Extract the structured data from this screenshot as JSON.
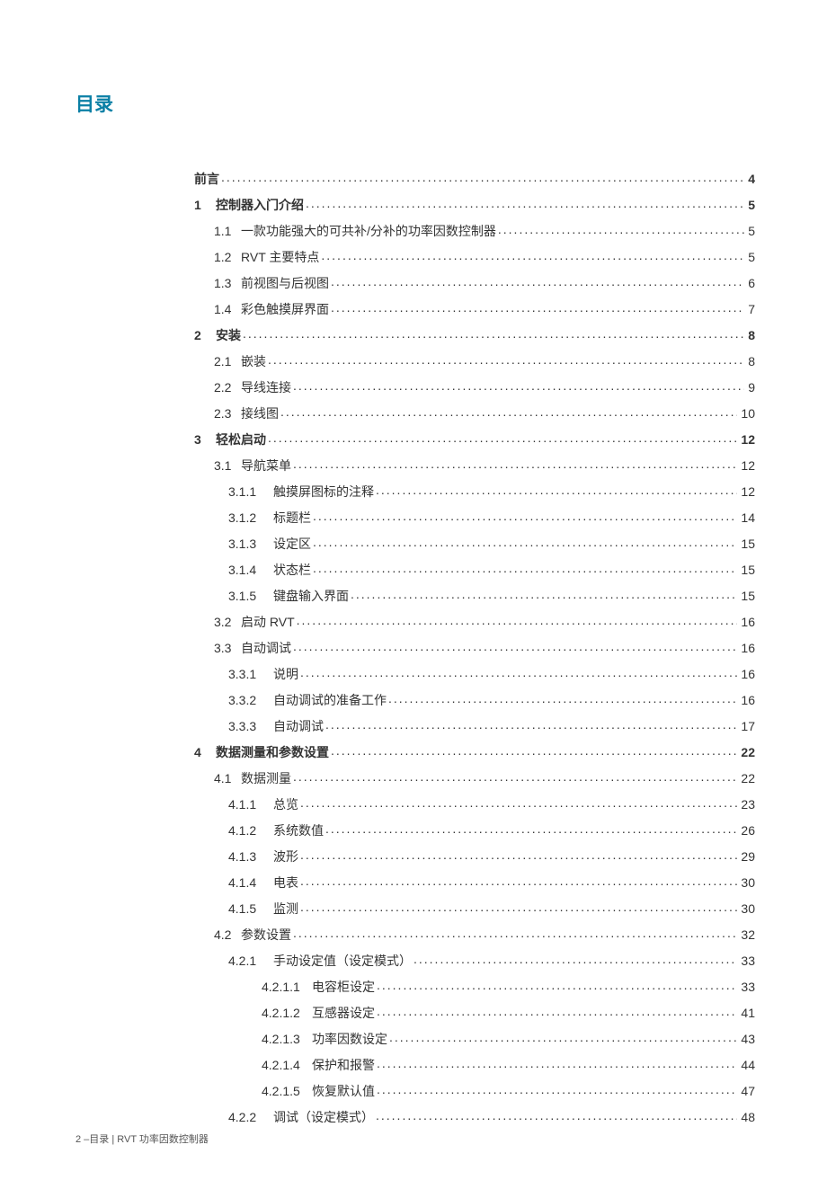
{
  "title": "目录",
  "footer": "2 –目录 | RVT 功率因数控制器",
  "toc": [
    {
      "level": 0,
      "bold": true,
      "num": "",
      "text": "前言",
      "page": "4"
    },
    {
      "level": 1,
      "bold": true,
      "num": "1",
      "text": "控制器入门介绍",
      "page": "5"
    },
    {
      "level": 2,
      "bold": false,
      "num": "1.1",
      "text": "一款功能强大的可共补/分补的功率因数控制器",
      "page": "5"
    },
    {
      "level": 2,
      "bold": false,
      "num": "1.2",
      "text": "RVT 主要特点",
      "page": "5"
    },
    {
      "level": 2,
      "bold": false,
      "num": "1.3",
      "text": "前视图与后视图",
      "page": "6"
    },
    {
      "level": 2,
      "bold": false,
      "num": "1.4",
      "text": "彩色触摸屏界面",
      "page": "7"
    },
    {
      "level": 1,
      "bold": true,
      "num": "2",
      "text": "安装",
      "page": "8"
    },
    {
      "level": 2,
      "bold": false,
      "num": "2.1",
      "text": "嵌装",
      "page": "8"
    },
    {
      "level": 2,
      "bold": false,
      "num": "2.2",
      "text": "导线连接",
      "page": "9"
    },
    {
      "level": 2,
      "bold": false,
      "num": "2.3",
      "text": "接线图",
      "page": "10"
    },
    {
      "level": 1,
      "bold": true,
      "num": "3",
      "text": "轻松启动",
      "page": "12"
    },
    {
      "level": 2,
      "bold": false,
      "num": "3.1",
      "text": "导航菜单",
      "page": "12"
    },
    {
      "level": 3,
      "bold": false,
      "num": "3.1.1",
      "text": "触摸屏图标的注释",
      "page": "12"
    },
    {
      "level": 3,
      "bold": false,
      "num": "3.1.2",
      "text": "标题栏",
      "page": "14"
    },
    {
      "level": 3,
      "bold": false,
      "num": "3.1.3",
      "text": "设定区",
      "page": "15"
    },
    {
      "level": 3,
      "bold": false,
      "num": "3.1.4",
      "text": "状态栏",
      "page": "15"
    },
    {
      "level": 3,
      "bold": false,
      "num": "3.1.5",
      "text": "键盘输入界面",
      "page": "15"
    },
    {
      "level": 2,
      "bold": false,
      "num": "3.2",
      "text": "启动 RVT",
      "page": "16"
    },
    {
      "level": 2,
      "bold": false,
      "num": "3.3",
      "text": "自动调试",
      "page": "16"
    },
    {
      "level": 3,
      "bold": false,
      "num": "3.3.1",
      "text": "说明",
      "page": "16"
    },
    {
      "level": 3,
      "bold": false,
      "num": "3.3.2",
      "text": "自动调试的准备工作",
      "page": "16"
    },
    {
      "level": 3,
      "bold": false,
      "num": "3.3.3",
      "text": "自动调试",
      "page": "17"
    },
    {
      "level": 1,
      "bold": true,
      "num": "4",
      "text": "数据测量和参数设置",
      "page": "22"
    },
    {
      "level": 2,
      "bold": false,
      "num": "4.1",
      "text": "数据测量",
      "page": "22"
    },
    {
      "level": 3,
      "bold": false,
      "num": "4.1.1",
      "text": "总览",
      "page": "23"
    },
    {
      "level": 3,
      "bold": false,
      "num": "4.1.2",
      "text": "系统数值",
      "page": "26"
    },
    {
      "level": 3,
      "bold": false,
      "num": "4.1.3",
      "text": "波形",
      "page": "29"
    },
    {
      "level": 3,
      "bold": false,
      "num": "4.1.4",
      "text": "电表",
      "page": "30"
    },
    {
      "level": 3,
      "bold": false,
      "num": "4.1.5",
      "text": "监测",
      "page": "30"
    },
    {
      "level": 2,
      "bold": false,
      "num": "4.2",
      "text": "参数设置",
      "page": "32"
    },
    {
      "level": 3,
      "bold": false,
      "num": "4.2.1",
      "text": "手动设定值（设定模式）",
      "page": "33"
    },
    {
      "level": 4,
      "bold": false,
      "num": "4.2.1.1",
      "text": "电容柜设定",
      "page": "33"
    },
    {
      "level": 4,
      "bold": false,
      "num": "4.2.1.2",
      "text": "互感器设定",
      "page": "41"
    },
    {
      "level": 4,
      "bold": false,
      "num": "4.2.1.3",
      "text": "功率因数设定",
      "page": "43"
    },
    {
      "level": 4,
      "bold": false,
      "num": "4.2.1.4",
      "text": "保护和报警",
      "page": "44"
    },
    {
      "level": 4,
      "bold": false,
      "num": "4.2.1.5",
      "text": "恢复默认值",
      "page": "47"
    },
    {
      "level": 3,
      "bold": false,
      "num": "4.2.2",
      "text": "调试（设定模式）",
      "page": "48"
    }
  ]
}
